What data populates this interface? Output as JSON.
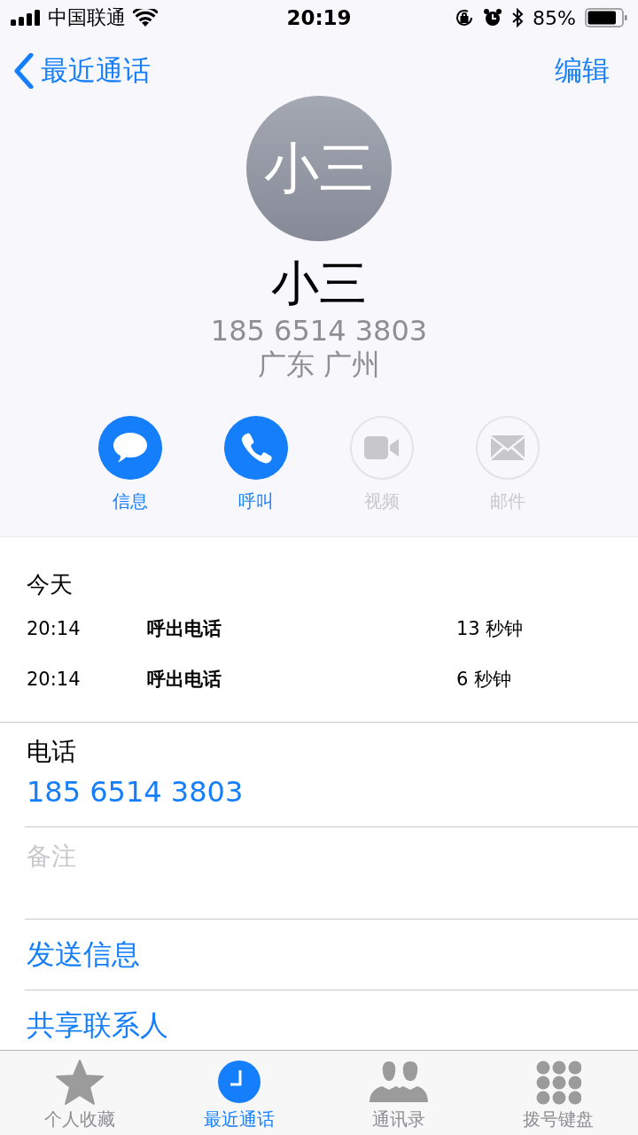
{
  "status_bar": {
    "carrier": "中国联通",
    "time": "20:19",
    "battery": "85%"
  },
  "nav": {
    "back": "最近通话",
    "action": "编辑"
  },
  "contact": {
    "avatar": "小三",
    "name": "小三",
    "phone": "185 6514 3803",
    "location": "广东 广州"
  },
  "actions": [
    {
      "label": "信息",
      "kind": "message",
      "disabled": false
    },
    {
      "label": "呼叫",
      "kind": "call",
      "disabled": false
    },
    {
      "label": "视频",
      "kind": "video",
      "disabled": true
    },
    {
      "label": "邮件",
      "kind": "mail",
      "disabled": true
    }
  ],
  "recents": {
    "heading": "今天",
    "calls": [
      {
        "time": "20:14",
        "type": "呼出电话",
        "duration": "13 秒钟"
      },
      {
        "time": "20:14",
        "type": "呼出电话",
        "duration": "6 秒钟"
      }
    ]
  },
  "phone_field": {
    "label": "电话",
    "value": "185 6514 3803"
  },
  "notes": {
    "label": "备注"
  },
  "links": [
    "发送信息",
    "共享联系人"
  ],
  "tabs": [
    {
      "label": "个人收藏",
      "kind": "favorites",
      "selected": false
    },
    {
      "label": "最近通话",
      "kind": "recents",
      "selected": true
    },
    {
      "label": "通讯录",
      "kind": "contacts",
      "selected": false
    },
    {
      "label": "拨号键盘",
      "kind": "keypad",
      "selected": false
    }
  ]
}
